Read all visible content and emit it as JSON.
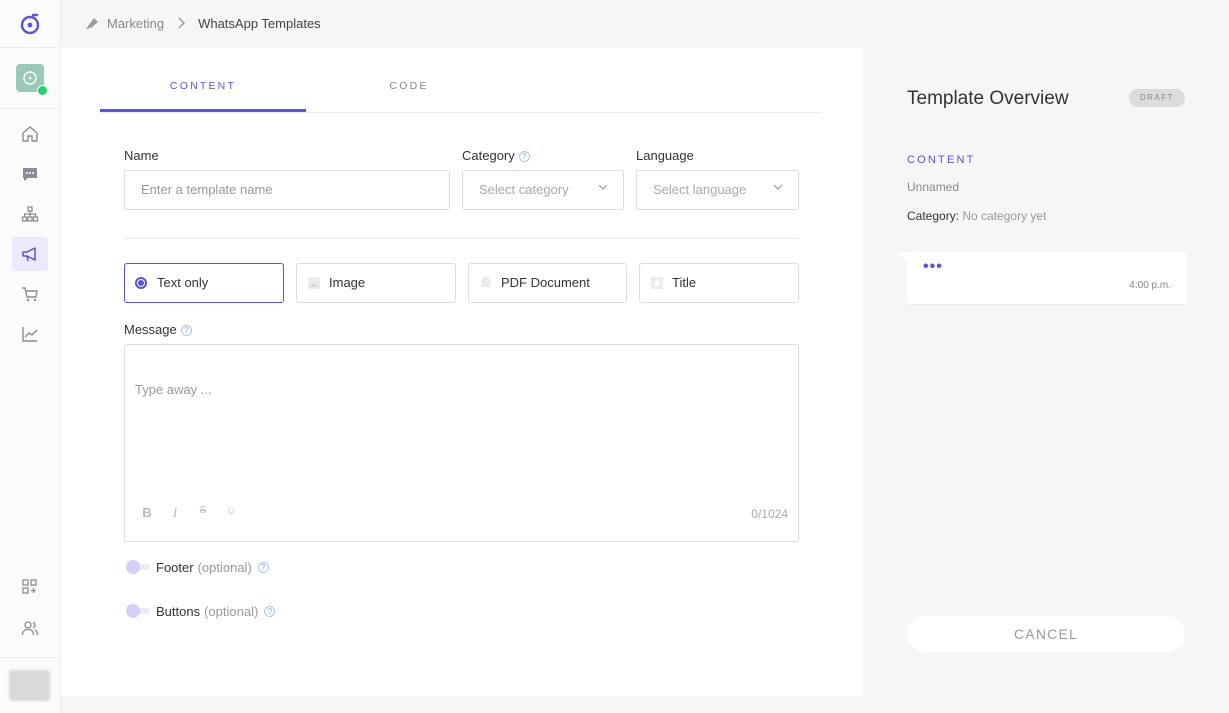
{
  "breadcrumb": {
    "parent": "Marketing",
    "current": "WhatsApp Templates"
  },
  "tabs": [
    {
      "label": "CONTENT"
    },
    {
      "label": "CODE"
    }
  ],
  "form": {
    "name_label": "Name",
    "name_placeholder": "Enter a template name",
    "category_label": "Category",
    "category_placeholder": "Select category",
    "language_label": "Language",
    "language_placeholder": "Select language",
    "help_glyph": "?",
    "header_options": [
      {
        "label": "Text only",
        "icon": "radio-selected"
      },
      {
        "label": "Image",
        "icon": "image-icon"
      },
      {
        "label": "PDF Document",
        "icon": "document-icon"
      },
      {
        "label": "Title",
        "icon": "title-icon"
      }
    ],
    "message_label": "Message",
    "message_placeholder": "Type away ...",
    "tools": [
      "B",
      "I",
      "S",
      "☺"
    ],
    "char_count": "0/1024",
    "footer_label": "Footer",
    "buttons_label": "Buttons",
    "optional": "(optional)"
  },
  "overview": {
    "title": "Template Overview",
    "status": "DRAFT",
    "section": "CONTENT",
    "name": "Unnamed",
    "category_label": "Category:",
    "category_value": "No category yet",
    "typing": "•••",
    "time": "4:00 p.m.",
    "cancel": "CANCEL"
  },
  "colors": {
    "accent": "#5b54d6",
    "whatsapp": "#25d366",
    "background": "#f6f6f7"
  }
}
